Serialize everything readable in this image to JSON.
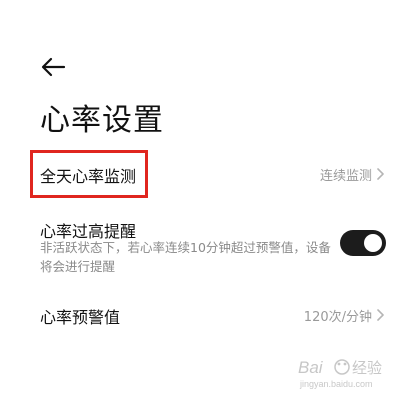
{
  "page": {
    "title": "心率设置"
  },
  "rows": {
    "all_day": {
      "label": "全天心率监测",
      "value": "连续监测"
    },
    "high_alert": {
      "label": "心率过高提醒",
      "description": "非活跃状态下，若心率连续10分钟超过预警值，设备将会进行提醒",
      "enabled": true
    },
    "threshold": {
      "label": "心率预警值",
      "value": "120次/分钟"
    }
  },
  "watermark": {
    "brand": "Baidu 经验",
    "url": "jingyan.baidu.com"
  },
  "colors": {
    "highlight": "#e0261f",
    "toggle_on": "#1c1c1c",
    "secondary_text": "#9a9a9a"
  },
  "icons": {
    "back": "arrow-left-icon",
    "chevron": "chevron-right-icon"
  }
}
